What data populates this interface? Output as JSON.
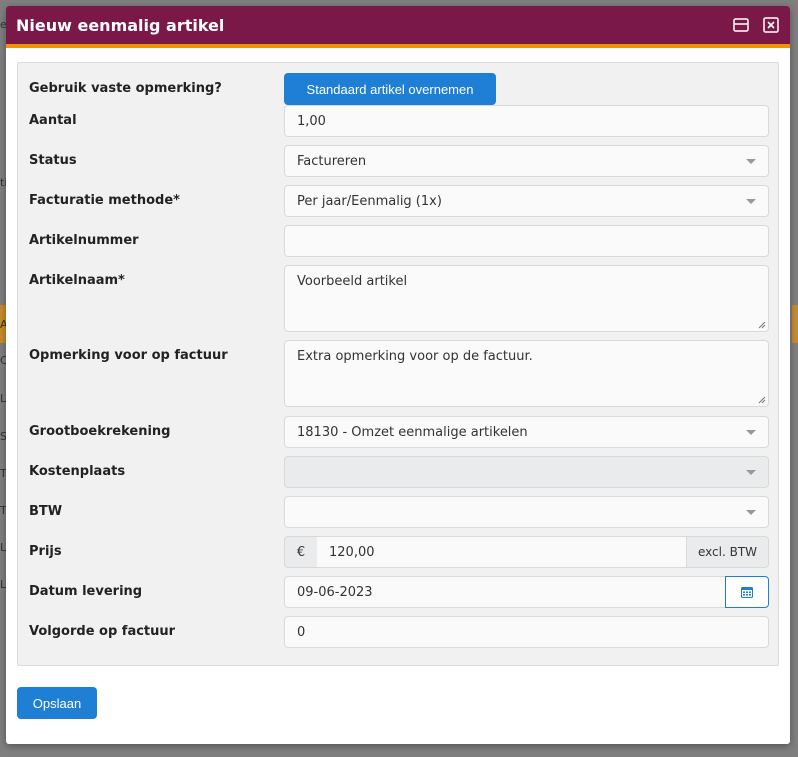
{
  "background": {
    "fragments": [
      "e",
      "ti",
      "A",
      "C",
      "Li",
      "Sa",
      "Tu",
      "Tr",
      "Le",
      "Le"
    ],
    "accent": "#f39200"
  },
  "modal": {
    "title": "Nieuw eenmalig artikel",
    "header_color": "#7a1848",
    "accent_color": "#f39200",
    "icons": {
      "maximize": "window-maximize-icon",
      "close": "close-icon"
    }
  },
  "form": {
    "vaste_opmerking": {
      "label": "Gebruik vaste opmerking?",
      "button": "Standaard artikel overnemen"
    },
    "aantal": {
      "label": "Aantal",
      "value": "1,00"
    },
    "status": {
      "label": "Status",
      "value": "Factureren"
    },
    "facturatie_methode": {
      "label": "Facturatie methode*",
      "value": "Per jaar/Eenmalig (1x)"
    },
    "artikelnummer": {
      "label": "Artikelnummer",
      "value": ""
    },
    "artikelnaam": {
      "label": "Artikelnaam*",
      "value": "Voorbeeld artikel"
    },
    "opmerking": {
      "label": "Opmerking voor op factuur",
      "value": "Extra opmerking voor op de factuur."
    },
    "grootboekrekening": {
      "label": "Grootboekrekening",
      "value": "18130 - Omzet eenmalige artikelen"
    },
    "kostenplaats": {
      "label": "Kostenplaats",
      "value": ""
    },
    "btw": {
      "label": "BTW",
      "value": ""
    },
    "prijs": {
      "label": "Prijs",
      "prefix": "€",
      "value": "120,00",
      "suffix": "excl. BTW"
    },
    "datum_levering": {
      "label": "Datum levering",
      "value": "09-06-2023",
      "icon": "calendar-icon"
    },
    "volgorde": {
      "label": "Volgorde op factuur",
      "value": "0"
    }
  },
  "footer": {
    "save_label": "Opslaan"
  },
  "colors": {
    "primary": "#1e7fd4",
    "panel": "#f1f1f1"
  }
}
